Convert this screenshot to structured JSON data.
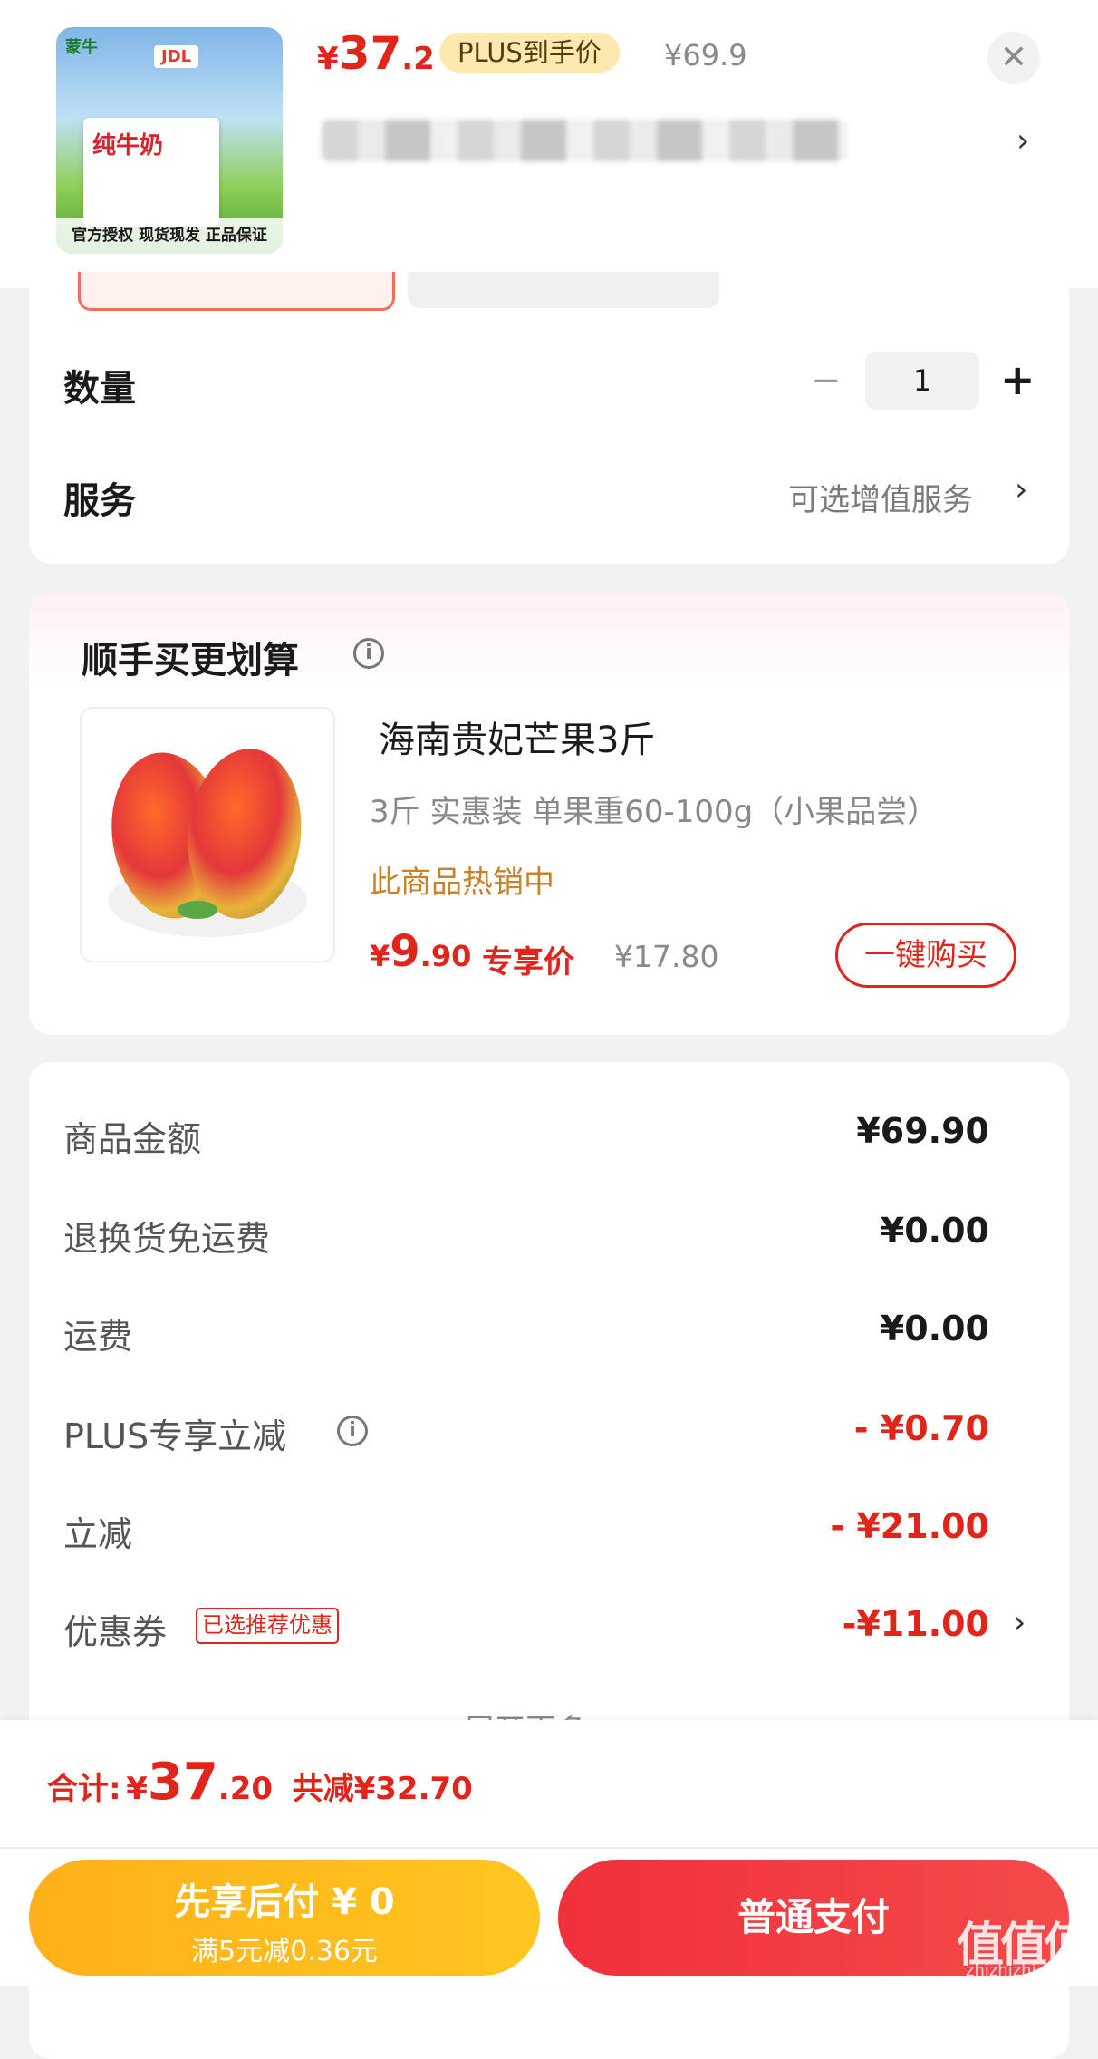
{
  "header": {
    "price_yen": "¥",
    "price_int": "37",
    "price_dec": ".2",
    "plus_tag": "PLUS到手价",
    "original_price": "¥69.9",
    "close_icon": "close-icon",
    "spec_chevron": "›",
    "thumb": {
      "brand": "蒙牛",
      "product": "纯牛奶",
      "jdl": "JDL",
      "footer": "官方授权  现货现发  正品保证"
    }
  },
  "quantity": {
    "label": "数量",
    "minus": "−",
    "value": "1",
    "plus": "+"
  },
  "service": {
    "label": "服务",
    "link": "可选增值服务",
    "chevron": "›"
  },
  "upsell": {
    "title": "顺手买更划算",
    "info_icon": "i",
    "name": "海南贵妃芒果3斤",
    "desc": "3斤 实惠装   单果重60-100g（小果品尝）",
    "hot": "此商品热销中",
    "price_yen": "¥",
    "price_int": "9",
    "price_dec": ".90",
    "price_tag": "专享价",
    "original_price": "¥17.80",
    "buy_button": "一键购买"
  },
  "summary": {
    "rows": [
      {
        "label": "商品金额",
        "value": "¥69.90"
      },
      {
        "label": "退换货免运费",
        "value": "¥0.00"
      },
      {
        "label": "运费",
        "value": "¥0.00"
      },
      {
        "label": "PLUS专享立减",
        "value": "- ¥0.70"
      },
      {
        "label": "立减",
        "value": "- ¥21.00"
      },
      {
        "label": "优惠券",
        "value": "-¥11.00"
      }
    ],
    "coupon_tag": "已选推荐优惠",
    "coupon_chevron": "›",
    "more": "展开更多"
  },
  "footer": {
    "total_label": "合计:",
    "total_yen": "¥",
    "total_int": "37",
    "total_dec": ".20",
    "total_saved": "共减¥32.70",
    "later_title": "先享后付 ¥ 0",
    "later_sub": "满5元减0.36元",
    "pay_button": "普通支付",
    "watermark": "值值值",
    "watermark_sub": "zhizhizhi.com"
  },
  "colors": {
    "accent": "#e1251b",
    "gold": "#ffb01a",
    "plus_bg": "#fde8b0"
  }
}
